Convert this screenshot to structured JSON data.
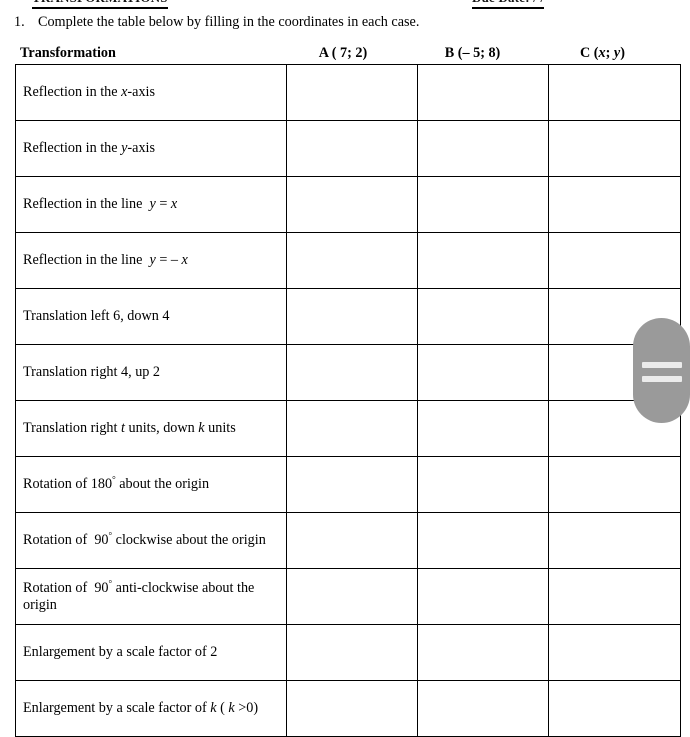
{
  "page": {
    "top_header_left": "TRANSFORMATIONS",
    "top_header_right": "Due Date:  /  /",
    "question_number": "1.",
    "question_text": "Complete the table below by filling in the coordinates in each case."
  },
  "table": {
    "columns": [
      {
        "id": "transformation",
        "label": "Transformation"
      },
      {
        "id": "point_a",
        "label": "A ( 7; 2)"
      },
      {
        "id": "point_b",
        "label": "B (– 5; 8)"
      },
      {
        "id": "point_c",
        "label": "C (x; y)"
      }
    ],
    "rows": [
      {
        "transformation": "Reflection in the x-axis",
        "a": "",
        "b": "",
        "c": ""
      },
      {
        "transformation": "Reflection in the y-axis",
        "a": "",
        "b": "",
        "c": ""
      },
      {
        "transformation": "Reflection in the line  y = x",
        "a": "",
        "b": "",
        "c": ""
      },
      {
        "transformation": "Reflection in the line  y = – x",
        "a": "",
        "b": "",
        "c": ""
      },
      {
        "transformation": "Translation left 6, down 4",
        "a": "",
        "b": "",
        "c": ""
      },
      {
        "transformation": "Translation right 4, up 2",
        "a": "",
        "b": "",
        "c": ""
      },
      {
        "transformation": "Translation right t units, down k units",
        "a": "",
        "b": "",
        "c": ""
      },
      {
        "transformation": "Rotation of 180° about the origin",
        "a": "",
        "b": "",
        "c": ""
      },
      {
        "transformation": "Rotation of  90° clockwise about the origin",
        "a": "",
        "b": "",
        "c": ""
      },
      {
        "transformation": "Rotation of  90° anti-clockwise about the origin",
        "a": "",
        "b": "",
        "c": ""
      },
      {
        "transformation": "Enlargement by a scale factor of 2",
        "a": "",
        "b": "",
        "c": ""
      },
      {
        "transformation": "Enlargement by a scale factor of k ( k >0)",
        "a": "",
        "b": "",
        "c": ""
      }
    ]
  },
  "drag_handle": {
    "color": "#9a9a9a",
    "bar_color": "#ebebeb"
  }
}
